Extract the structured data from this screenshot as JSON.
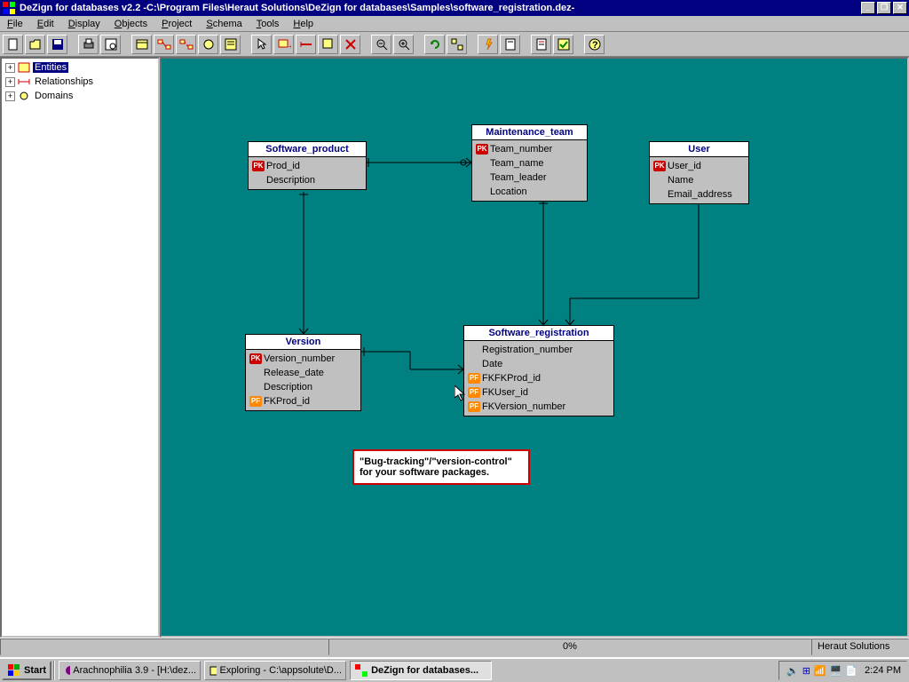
{
  "window": {
    "title": "DeZign for databases v2.2 -C:\\Program Files\\Heraut Solutions\\DeZign for databases\\Samples\\software_registration.dez-"
  },
  "menu": [
    "File",
    "Edit",
    "Display",
    "Objects",
    "Project",
    "Schema",
    "Tools",
    "Help"
  ],
  "tree": {
    "items": [
      {
        "label": "Entities",
        "selected": true
      },
      {
        "label": "Relationships",
        "selected": false
      },
      {
        "label": "Domains",
        "selected": false
      }
    ]
  },
  "entities": {
    "software_product": {
      "title": "Software_product",
      "fields": [
        {
          "key": "PK",
          "name": "Prod_id"
        },
        {
          "key": "",
          "name": "Description"
        }
      ]
    },
    "maintenance_team": {
      "title": "Maintenance_team",
      "fields": [
        {
          "key": "PK",
          "name": "Team_number"
        },
        {
          "key": "",
          "name": "Team_name"
        },
        {
          "key": "",
          "name": "Team_leader"
        },
        {
          "key": "",
          "name": "Location"
        }
      ]
    },
    "user": {
      "title": "User",
      "fields": [
        {
          "key": "PK",
          "name": "User_id"
        },
        {
          "key": "",
          "name": "Name"
        },
        {
          "key": "",
          "name": "Email_address"
        }
      ]
    },
    "version": {
      "title": "Version",
      "fields": [
        {
          "key": "PK",
          "name": "Version_number"
        },
        {
          "key": "",
          "name": "Release_date"
        },
        {
          "key": "",
          "name": "Description"
        },
        {
          "key": "PF",
          "name": "FKProd_id"
        }
      ]
    },
    "software_registration": {
      "title": "Software_registration",
      "fields": [
        {
          "key": "",
          "name": "Registration_number"
        },
        {
          "key": "",
          "name": "Date"
        },
        {
          "key": "PF",
          "name": "FKFKProd_id"
        },
        {
          "key": "PF",
          "name": "FKUser_id"
        },
        {
          "key": "PF",
          "name": "FKVersion_number"
        }
      ]
    }
  },
  "note": "\"Bug-tracking\"/\"version-control\" for your software packages.",
  "status": {
    "progress": "0%",
    "company": "Heraut Solutions"
  },
  "taskbar": {
    "start": "Start",
    "tasks": [
      {
        "label": "Arachnophilia 3.9 - [H:\\dez...",
        "active": false
      },
      {
        "label": "Exploring - C:\\appsolute\\D...",
        "active": false
      },
      {
        "label": "DeZign for databases...",
        "active": true
      }
    ],
    "clock": "2:24 PM"
  }
}
